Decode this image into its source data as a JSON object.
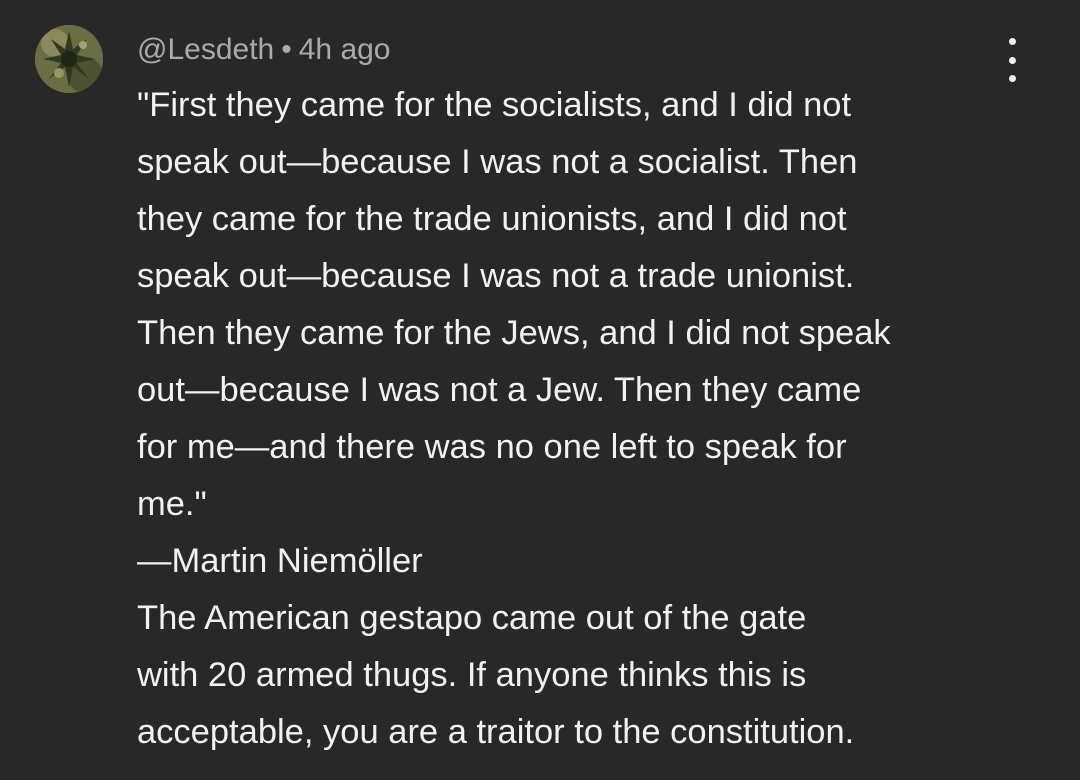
{
  "comment": {
    "author": "@Lesdeth",
    "separator": "•",
    "timestamp": "4h ago",
    "avatar_icon": "user-avatar-image",
    "menu_icon": "more-vert-icon",
    "lines": [
      "\"First they came for the socialists, and I did not",
      "speak out—because I was not a socialist. Then",
      "they came for the trade unionists, and I did not",
      "speak out—because I was not a trade unionist.",
      "Then they came for the Jews, and I did not speak",
      "out—because I was not a Jew. Then they came",
      "for me—and there was no one left to speak for",
      "me.\"",
      "—Martin Niemöller",
      "The American gestapo came out of the gate",
      "with 20 armed thugs. If anyone thinks this is",
      "acceptable, you are a traitor to the constitution."
    ]
  },
  "colors": {
    "background": "#282828",
    "text": "#f1f1f1",
    "secondary_text": "#aaaaaa"
  }
}
